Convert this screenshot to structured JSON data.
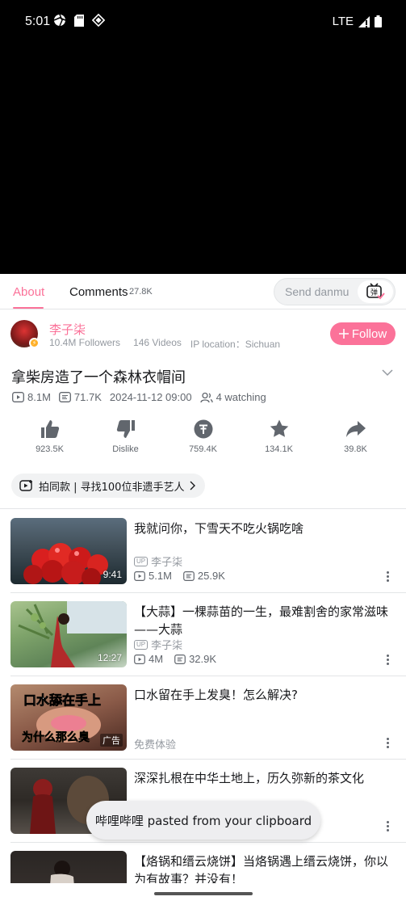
{
  "status_bar": {
    "time": "5:01",
    "network": "LTE"
  },
  "tabs": {
    "about": "About",
    "comments": "Comments",
    "comments_count": "27.8K",
    "danmu_placeholder": "Send danmu"
  },
  "uploader": {
    "name": "李子柒",
    "followers": "10.4M Followers",
    "videos": "146 Videos",
    "ip": "IP location：Sichuan",
    "follow_label": "Follow"
  },
  "video": {
    "title": "拿柴房造了一个森林衣帽间",
    "views": "8.1M",
    "danmaku": "71.7K",
    "date": "2024-11-12 09:00",
    "watching": "4 watching"
  },
  "actions": [
    {
      "label": "923.5K",
      "icon": "thumbs-up-icon"
    },
    {
      "label": "Dislike",
      "icon": "thumbs-down-icon"
    },
    {
      "label": "759.4K",
      "icon": "coin-icon"
    },
    {
      "label": "134.1K",
      "icon": "star-icon"
    },
    {
      "label": "39.8K",
      "icon": "share-icon"
    }
  ],
  "tag": {
    "text": "拍同款 | 寻找100位非遗手艺人"
  },
  "recommendations": [
    {
      "title": "我就问你，下雪天不吃火锅吃啥",
      "duration": "9:41",
      "up": "李子柒",
      "views": "5.1M",
      "danmaku": "25.9K"
    },
    {
      "title": "【大蒜】一棵蒜苗的一生，最难割舍的家常滋味——大蒜",
      "duration": "12:27",
      "up": "李子柒",
      "views": "4M",
      "danmaku": "32.9K"
    },
    {
      "title": "口水留在手上发臭！怎么解决?",
      "ad_badge": "广告",
      "ad_text_top": "口水舔在手上",
      "ad_text_bottom": "为什么那么臭",
      "sponsor": "免费体验"
    },
    {
      "title": "深深扎根在中华土地上，历久弥新的茶文化"
    },
    {
      "title": "【烙锅和缙云烧饼】当烙锅遇上缙云烧饼，你以为有故事？并没有！"
    }
  ],
  "toast": {
    "text": "哔哩哔哩 pasted from your clipboard"
  },
  "colors": {
    "accent": "#fb7299",
    "text": "#18191c",
    "muted": "#9499a0"
  }
}
